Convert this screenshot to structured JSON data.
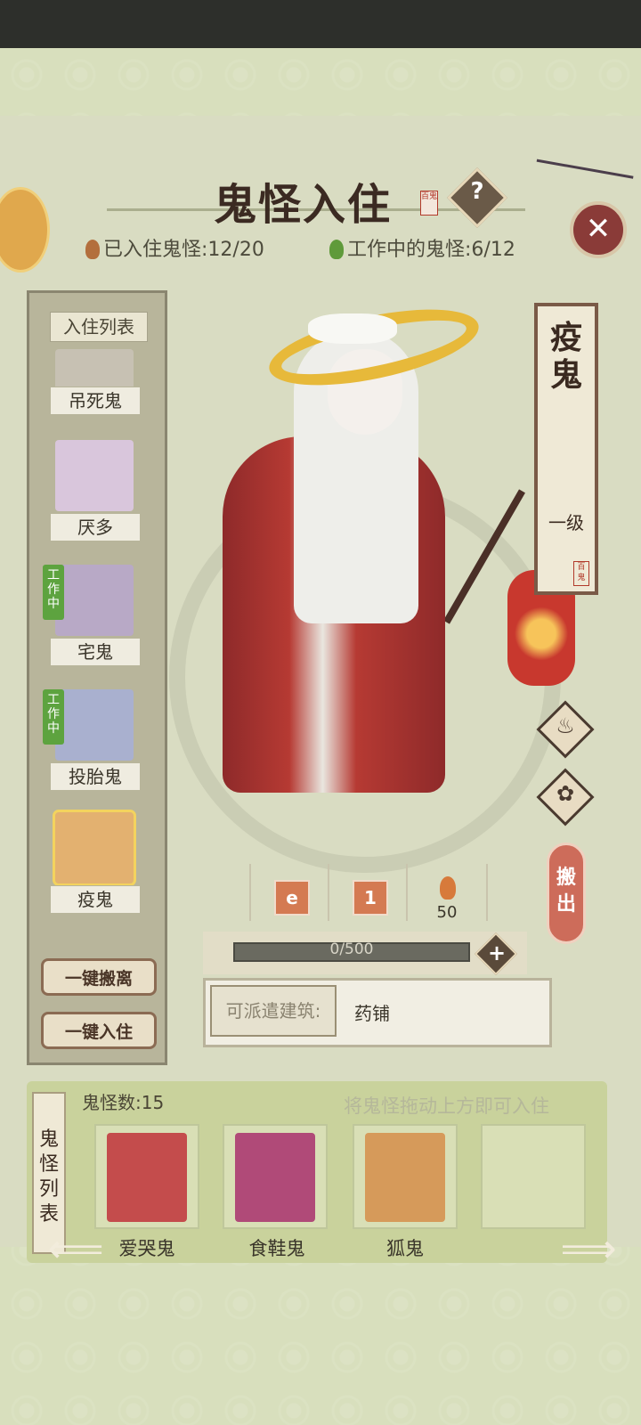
{
  "header": {
    "title": "鬼怪入住",
    "seal": "百鬼",
    "help_icon": "question-icon",
    "close_icon": "close-icon",
    "resident_stat": "已入住鬼怪:12/20",
    "working_stat": "工作中的鬼怪:6/12"
  },
  "left_list": {
    "title": "入住列表",
    "items": [
      {
        "name": "吊死鬼",
        "working": false,
        "art_color": "#c7c1b3"
      },
      {
        "name": "厌多",
        "working": false,
        "art_color": "#d9c6dc"
      },
      {
        "name": "宅鬼",
        "working": true,
        "work_label": "工作中",
        "art_color": "#b8a9c6"
      },
      {
        "name": "投胎鬼",
        "working": true,
        "work_label": "工作中",
        "art_color": "#a9b0cf"
      },
      {
        "name": "疫鬼",
        "working": false,
        "selected": true,
        "art_color": "#e3b170"
      }
    ],
    "evict_all_label": "一键搬离",
    "move_in_all_label": "一键入住"
  },
  "detail": {
    "name": "疫鬼",
    "level": "一级",
    "seal": "百鬼",
    "stats": [
      {
        "type": "icon",
        "icon": "swirl-icon",
        "value": ""
      },
      {
        "type": "icon",
        "icon": "level-badge-icon",
        "value": "1"
      },
      {
        "type": "flame",
        "icon": "flame-icon",
        "value": "50"
      }
    ],
    "xp_text": "0/500",
    "xp_progress": 0,
    "building_label": "可派遣建筑:",
    "building_value": "药铺",
    "move_out_label": "搬出",
    "side_buttons": [
      "fire-swirl-icon",
      "bag-icon"
    ]
  },
  "bottom": {
    "tab_label": "鬼怪列表",
    "count": "鬼怪数:15",
    "hint": "将鬼怪拖动上方即可入住",
    "slots": [
      {
        "name": "爱哭鬼",
        "art_color": "#c44c4c"
      },
      {
        "name": "食鞋鬼",
        "art_color": "#b04a78"
      },
      {
        "name": "狐鬼",
        "art_color": "#d69a5a"
      }
    ]
  }
}
